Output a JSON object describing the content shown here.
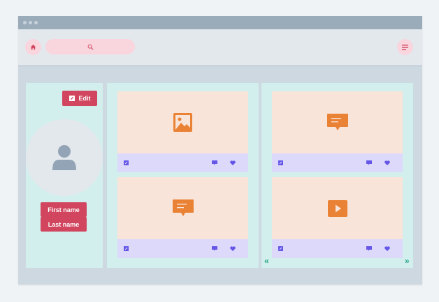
{
  "window": {
    "title": ""
  },
  "navbar": {
    "home_icon": "home-icon",
    "search_icon": "search-icon",
    "search_placeholder": "",
    "menu_icon": "menu-icon"
  },
  "profile": {
    "edit_label": "Edit",
    "edit_icon": "edit-icon",
    "avatar_icon": "user-icon",
    "first_name_label": "First name",
    "last_name_label": "Last name"
  },
  "columns": [
    {
      "cards": [
        {
          "type": "image",
          "icon": "image-icon"
        },
        {
          "type": "comment",
          "icon": "message-icon"
        }
      ]
    },
    {
      "cards": [
        {
          "type": "comment",
          "icon": "message-icon"
        },
        {
          "type": "video",
          "icon": "play-icon"
        }
      ],
      "pager": {
        "prev": "«",
        "next": "»"
      }
    }
  ],
  "card_actions": [
    "edit-icon",
    "comment-icon",
    "heart-icon"
  ],
  "colors": {
    "accent": "#d1455e",
    "panel": "#d2efed",
    "media": "#f9e4d9",
    "media_icon": "#ea8235",
    "footer": "#ddd9fb",
    "footer_icon": "#6457e8",
    "pager": "#2fa98f",
    "titlebar": "#9aabba"
  }
}
